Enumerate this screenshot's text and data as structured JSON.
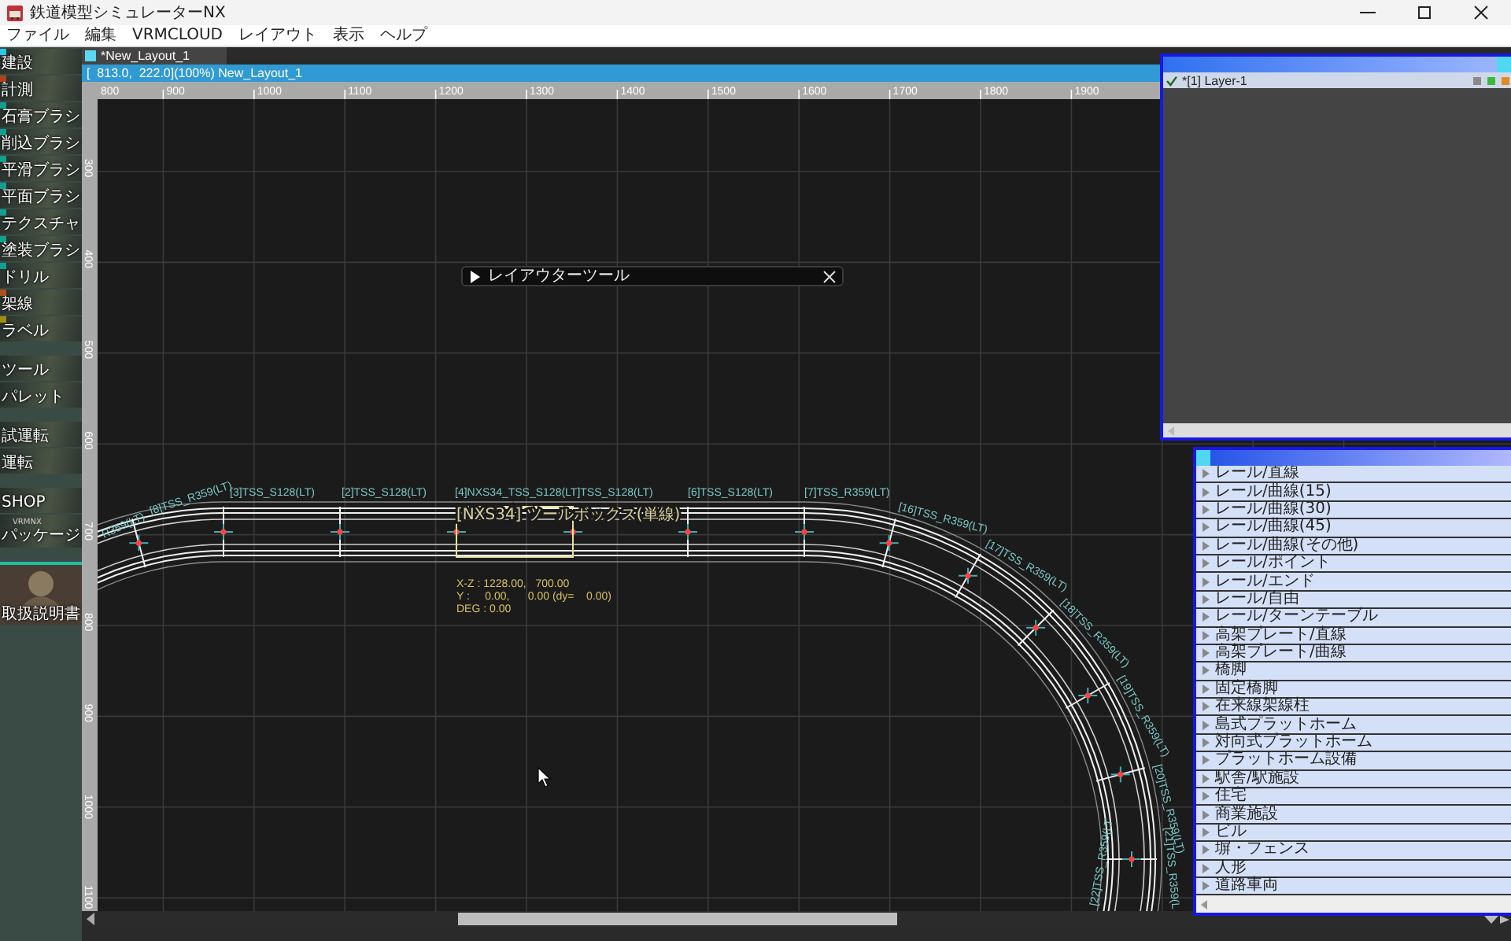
{
  "window": {
    "title": "鉄道模型シミュレーターNX"
  },
  "menu": [
    "ファイル",
    "編集",
    "VRMCLOUD",
    "レイアウト",
    "表示",
    "ヘルプ"
  ],
  "toolbar": [
    {
      "items": [
        {
          "label": "建設",
          "kind": "tool",
          "color": "#2ac8e8"
        },
        {
          "label": "計測",
          "kind": "tool",
          "color": "#b0401a"
        },
        {
          "label": "石膏ブラシ",
          "kind": "tool",
          "color": "#10a090"
        },
        {
          "label": "削込ブラシ",
          "kind": "tool",
          "color": "#10a090"
        },
        {
          "label": "平滑ブラシ",
          "kind": "tool",
          "color": "#10a090"
        },
        {
          "label": "平面ブラシ",
          "kind": "tool",
          "color": "#10a090"
        },
        {
          "label": "テクスチャ",
          "kind": "tool",
          "color": "#10a090"
        },
        {
          "label": "塗装ブラシ",
          "kind": "tool",
          "color": "#10a090"
        },
        {
          "label": "ドリル",
          "kind": "tool",
          "color": "#10a090"
        },
        {
          "label": "架線",
          "kind": "tool",
          "color": "#b0501a"
        },
        {
          "label": "ラベル",
          "kind": "tool",
          "color": "#a09010"
        }
      ]
    },
    {
      "items": [
        {
          "label": "ツール",
          "kind": "tool"
        },
        {
          "label": "パレット",
          "kind": "tool"
        }
      ]
    },
    {
      "items": [
        {
          "label": "試運転",
          "kind": "tool"
        },
        {
          "label": "運転",
          "kind": "tool"
        }
      ]
    },
    {
      "items": [
        {
          "label": "SHOP",
          "kind": "tool"
        },
        {
          "label": "パッケージ",
          "kind": "tool",
          "caption": "VRMNX"
        }
      ]
    },
    {
      "items": [
        {
          "label": "取扱説明書",
          "kind": "manual"
        }
      ]
    }
  ],
  "document_tab": {
    "label": "*New_Layout_1"
  },
  "status_line": "[  813.0,  222.0](100%) New_Layout_1",
  "ruler": {
    "x_labels": [
      "800",
      "900",
      "1000",
      "1100",
      "1200",
      "1300",
      "1400",
      "1500",
      "1600",
      "1700",
      "1800",
      "1900"
    ],
    "y_labels": [
      "300",
      "400",
      "500",
      "600",
      "700",
      "800",
      "900",
      "1000",
      "1100"
    ]
  },
  "layout_tool": {
    "title": "レイアウターツール",
    "expanded": false
  },
  "layers": [
    {
      "label": "*[1] Layer-1",
      "visible": true
    }
  ],
  "parts": [
    {
      "label": "レール/直線",
      "expanded": false
    },
    {
      "label": "レール/曲線(15)",
      "expanded": false
    },
    {
      "label": "レール/曲線(30)",
      "expanded": false
    },
    {
      "label": "レール/曲線(45)",
      "expanded": false
    },
    {
      "label": "レール/曲線(その他)",
      "expanded": false
    },
    {
      "label": "レール/ポイント",
      "expanded": false
    },
    {
      "label": "レール/エンド",
      "expanded": false
    },
    {
      "label": "レール/自由",
      "expanded": false
    },
    {
      "label": "レール/ターンテーブル",
      "expanded": false
    },
    {
      "label": "高架プレート/直線",
      "expanded": false
    },
    {
      "label": "高架プレート/曲線",
      "expanded": false
    },
    {
      "label": "橋脚",
      "expanded": false
    },
    {
      "label": "固定橋脚",
      "expanded": false
    },
    {
      "label": "在来線架線柱",
      "expanded": false
    },
    {
      "label": "島式プラットホーム",
      "expanded": false
    },
    {
      "label": "対向式プラットホーム",
      "expanded": false
    },
    {
      "label": "プラットホーム設備",
      "expanded": false
    },
    {
      "label": "駅舎/駅施設",
      "expanded": false
    },
    {
      "label": "住宅",
      "expanded": false
    },
    {
      "label": "商業施設",
      "expanded": false
    },
    {
      "label": "ビル",
      "expanded": false
    },
    {
      "label": "塀・フェンス",
      "expanded": false
    },
    {
      "label": "人形",
      "expanded": false
    },
    {
      "label": "道路車両",
      "expanded": false
    }
  ],
  "track": {
    "left_labels": [
      "R359(LT)",
      "[8]TSS_R359(LT)"
    ],
    "straight_labels": [
      "[3]TSS_S128(LT)",
      "[2]TSS_S128(LT)",
      "[4]NXS34_TSS_S128(LT]TSS_S128(LT)",
      "[6]TSS_S128(LT)",
      "[7]TSS_R359(LT)"
    ],
    "curve_labels": [
      "[16]TSS_R359(LT)",
      "[17]TSS_R359(LT)",
      "[18]TSS_R359(LT)",
      "[19]TSS_R359(LT)",
      "[20]TSS_R359(LT)",
      "[21]TSS_R359(L"
    ],
    "inner_labels": [
      "[22]TSS_R359(LT"
    ]
  },
  "selection": {
    "caption": "[NXS34] ツールボックス(単線)",
    "readout": [
      "X-Z : 1228.00,   700.00",
      "Y :     0.00,      0.00 (dy=    0.00)",
      "DEG : 0.00"
    ]
  }
}
